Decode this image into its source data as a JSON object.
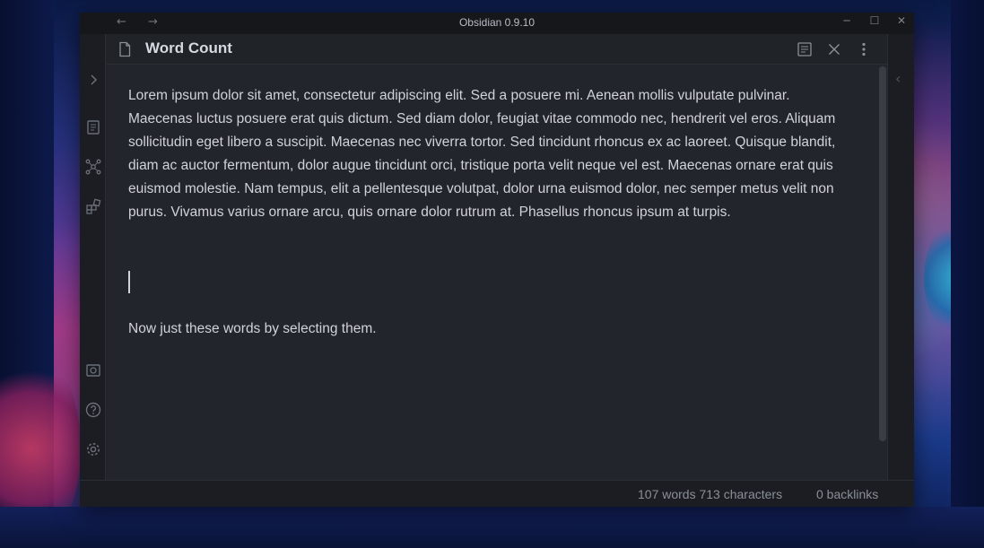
{
  "window": {
    "title": "Obsidian 0.9.10",
    "nav_back": "←",
    "nav_forward": "→",
    "minimize": "─",
    "maximize": "☐",
    "close": "✕"
  },
  "pane": {
    "title": "Word Count"
  },
  "editor": {
    "paragraph1": "Lorem ipsum dolor sit amet, consectetur adipiscing elit. Sed a posuere mi. Aenean mollis vulputate pulvinar. Maecenas luctus posuere erat quis dictum. Sed diam dolor, feugiat vitae commodo nec, hendrerit vel eros. Aliquam sollicitudin eget libero a suscipit. Maecenas nec viverra tortor. Sed tincidunt rhoncus ex ac laoreet. Quisque blandit, diam ac auctor fermentum, dolor augue tincidunt orci, tristique porta velit neque vel est. Maecenas ornare erat quis euismod molestie. Nam tempus, elit a pellentesque volutpat, dolor urna euismod dolor, nec semper metus velit non purus. Vivamus varius ornare arcu, quis ornare dolor rutrum at. Phasellus rhoncus ipsum at turpis.",
    "paragraph2": "Now just these words by selecting them."
  },
  "statusbar": {
    "word_count": "107 words 713 characters",
    "backlinks": "0 backlinks"
  },
  "icons": {
    "ribbon": [
      "chevron-right-icon",
      "files-icon",
      "graph-icon",
      "plugins-icon",
      "vault-icon",
      "help-icon",
      "settings-icon"
    ],
    "header": [
      "document-icon",
      "preview-toggle-icon",
      "close-icon",
      "more-options-icon"
    ]
  }
}
